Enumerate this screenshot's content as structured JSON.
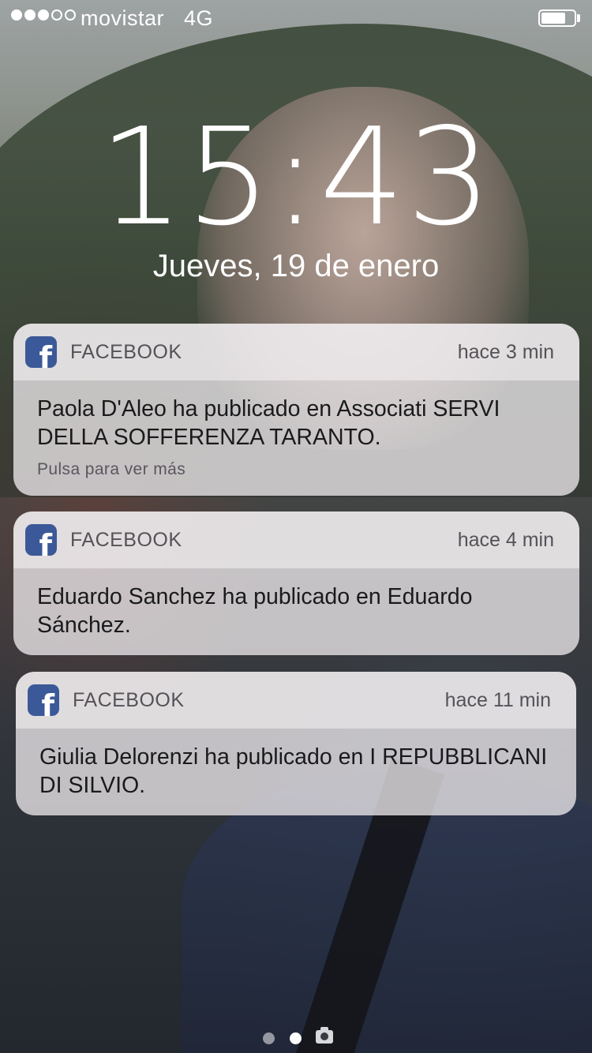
{
  "status_bar": {
    "signal_bars_filled": 3,
    "signal_bars_total": 5,
    "carrier": "movistar",
    "network": "4G",
    "battery_level": 0.75
  },
  "lock_screen": {
    "time": "15:43",
    "date": "Jueves, 19 de enero"
  },
  "notifications": [
    {
      "app": "FACEBOOK",
      "app_icon": "facebook-icon",
      "time_ago": "hace 3 min",
      "text": "Paola D'Aleo ha publicado en Associati SERVI DELLA SOFFERENZA TARANTO.",
      "hint": "Pulsa para ver más"
    },
    {
      "app": "FACEBOOK",
      "app_icon": "facebook-icon",
      "time_ago": "hace 4 min",
      "text": "Eduardo Sanchez ha publicado en Eduardo Sánchez."
    },
    {
      "app": "FACEBOOK",
      "app_icon": "facebook-icon",
      "time_ago": "hace 11 min",
      "text": "Giulia Delorenzi ha publicado en I REPUBBLICANI DI SILVIO."
    }
  ],
  "pager": {
    "pages": 2,
    "current_page": 2,
    "camera_icon": "camera-icon"
  },
  "colors": {
    "facebook_blue": "#3b5998",
    "notification_bg": "#ece8ea"
  }
}
